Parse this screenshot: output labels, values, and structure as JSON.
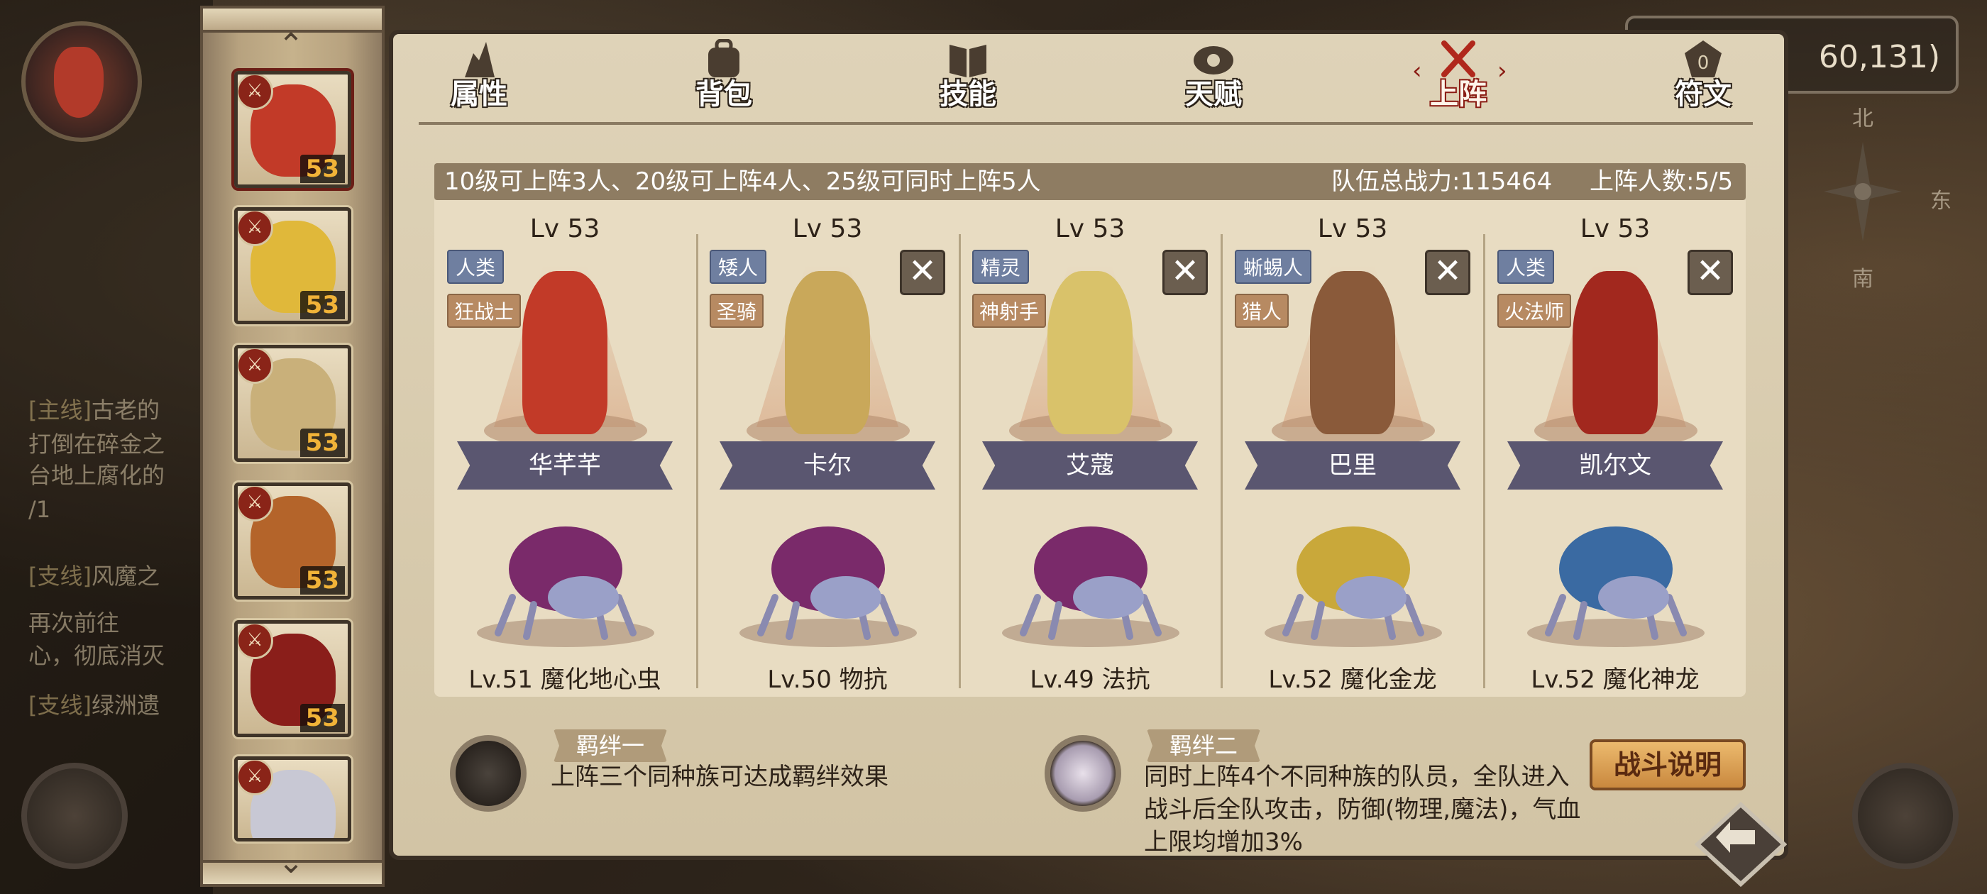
{
  "background": {
    "coords": "60,131)",
    "compass": {
      "north": "北",
      "east": "东",
      "south": "南"
    },
    "quests": [
      {
        "tag": "[主线]",
        "text": "古老的"
      },
      {
        "tag": "",
        "text": "打倒在碎金之"
      },
      {
        "tag": "",
        "text": "台地上腐化的"
      },
      {
        "tag": "",
        "text": "/1"
      },
      {
        "tag": "[支线]",
        "text": "风魔之"
      },
      {
        "tag": "",
        "text": "再次前往"
      },
      {
        "tag": "",
        "text": "心，彻底消灭"
      },
      {
        "tag": "[支线]",
        "text": "绿洲遗"
      }
    ]
  },
  "side_roster": {
    "items": [
      {
        "level": "53",
        "face_color": "#c23a28",
        "selected": true
      },
      {
        "level": "53",
        "face_color": "#e0b83a",
        "selected": false
      },
      {
        "level": "53",
        "face_color": "#c9b07a",
        "selected": false
      },
      {
        "level": "53",
        "face_color": "#b4642a",
        "selected": false
      },
      {
        "level": "53",
        "face_color": "#8a1e1a",
        "selected": false
      },
      {
        "level": "",
        "face_color": "#c8c8d4",
        "selected": false
      }
    ]
  },
  "tabs": [
    {
      "label": "属性",
      "icon": "attribute-icon"
    },
    {
      "label": "背包",
      "icon": "backpack-icon"
    },
    {
      "label": "技能",
      "icon": "skill-book-icon"
    },
    {
      "label": "天赋",
      "icon": "talent-icon"
    },
    {
      "label": "上阵",
      "icon": "crossed-swords-icon",
      "active": true
    },
    {
      "label": "符文",
      "icon": "rune-icon"
    }
  ],
  "info_bar": {
    "rule": "10级可上阵3人、20级可上阵4人、25级可同时上阵5人",
    "power_label": "队伍总战力:",
    "power_value": "115464",
    "count_label": "上阵人数:",
    "count_value": "5/5"
  },
  "team": [
    {
      "level": "Lv 53",
      "race": "人类",
      "job": "狂战士",
      "name": "华芊芊",
      "removable": false,
      "color": "#c23a28",
      "pet": {
        "label": "Lv.51 魔化地心虫",
        "color": "#7a2a6a"
      }
    },
    {
      "level": "Lv 53",
      "race": "矮人",
      "job": "圣骑",
      "name": "卡尔",
      "removable": true,
      "color": "#c9a85a",
      "pet": {
        "label": "Lv.50 物抗",
        "color": "#7a2a6a"
      }
    },
    {
      "level": "Lv 53",
      "race": "精灵",
      "job": "神射手",
      "name": "艾蔻",
      "removable": true,
      "color": "#d9c26a",
      "pet": {
        "label": "Lv.49 法抗",
        "color": "#7a2a6a"
      }
    },
    {
      "level": "Lv 53",
      "race": "蜥蜴人",
      "job": "猎人",
      "name": "巴里",
      "removable": true,
      "color": "#8a5a3a",
      "pet": {
        "label": "Lv.52 魔化金龙",
        "color": "#c9a83a"
      }
    },
    {
      "level": "Lv 53",
      "race": "人类",
      "job": "火法师",
      "name": "凯尔文",
      "removable": true,
      "color": "#a2281e",
      "pet": {
        "label": "Lv.52 魔化神龙",
        "color": "#3a6aa2"
      }
    }
  ],
  "bonds": [
    {
      "title": "羁绊一",
      "text": "上阵三个同种族可达成羁绊效果"
    },
    {
      "title": "羁绊二",
      "text_lines": [
        "同时上阵4个不同种族的队员，全队进入",
        "战斗后全队攻击，防御(物理,魔法)，气血",
        "上限均增加3%"
      ]
    }
  ],
  "battle_info_label": "战斗说明",
  "remove_glyph": "✕",
  "icons": {
    "up": "⌃",
    "down": "⌄",
    "back": "back-arrow-icon"
  }
}
